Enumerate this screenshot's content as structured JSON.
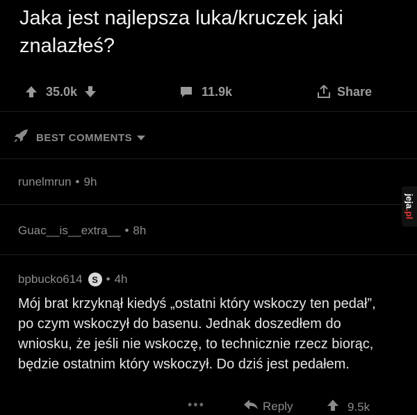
{
  "post": {
    "title": "Jaka jest najlepsza luka/kruczek jaki znalazłeś?",
    "upvotes": "35.0k",
    "comments": "11.9k",
    "share_label": "Share"
  },
  "sort": {
    "label": "BEST COMMENTS"
  },
  "comments": [
    {
      "author": "runelmrun",
      "sep": "•",
      "age": "9h"
    },
    {
      "author": "Guac__is__extra__",
      "sep": "•",
      "age": "8h"
    },
    {
      "author": "bpbucko614",
      "badge": "S",
      "sep": "•",
      "age": "4h",
      "body": "Mój brat krzyknął kiedyś „ostatni który wskoczy ten pedał”, po czym wskoczył do basenu. Jednak doszedłem do wniosku, że jeśli nie wskoczę, to technicznie rzecz biorąc, będzie ostatnim który wskoczył. Do dziś jest pedałem.",
      "more": "•••",
      "reply_label": "Reply",
      "upvotes": "9.5k"
    }
  ],
  "watermark": {
    "text_main": "jeja",
    "text_tld": ".pl"
  },
  "icons": [
    "upvote-icon",
    "downvote-icon",
    "comment-icon",
    "share-icon",
    "rocket-icon",
    "caret-down-icon",
    "reply-icon"
  ],
  "colors": {
    "background": "#000000",
    "text": "#e6e6e6",
    "muted": "#8d8d8d",
    "watermark_accent": "#e53935"
  }
}
